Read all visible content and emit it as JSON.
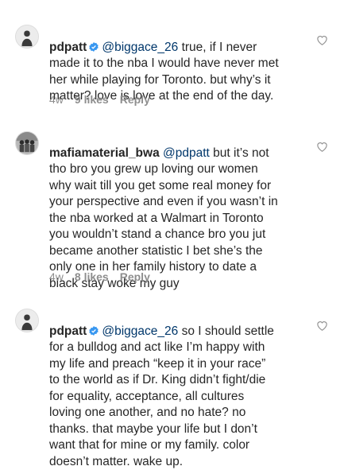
{
  "comments": [
    {
      "username": "pdpatt",
      "verified": true,
      "mention": "@biggace_26",
      "text": " true, if I never\nmade it to the nba I would have never met\nher while playing for Toronto. but why’s it\nmatter? love is love at the end of the day.",
      "time": "4w",
      "likes": "9 likes",
      "reply": "Reply"
    },
    {
      "username": "mafiamaterial_bwa",
      "verified": false,
      "mention": "@pdpatt",
      "text": " but it’s not\ntho bro you grew up loving our women\nwhy wait till you get some real money for\nyour perspective and even if you wasn’t in\nthe nba worked at a Walmart in Toronto\nyou wouldn’t stand a chance bro you jut\nbecame another statistic I bet she’s the\nonly one in her family history to date a\nblack stay woke my guy",
      "time": "4w",
      "likes": "8 likes",
      "reply": "Reply"
    },
    {
      "username": "pdpatt",
      "verified": true,
      "mention": "@biggace_26",
      "text": " so I should settle\nfor a bulldog and act like I’m happy with\nmy life and preach “keep it in your race”\nto the world as if Dr. King didn’t fight/die\nfor equality, acceptance, all cultures\nloving one another, and no hate? no\nthanks. that maybe your life but I don’t\nwant that for mine or my family. color\ndoesn’t matter. wake up."
    }
  ],
  "icons": {
    "heart": "heart-outline-icon",
    "verified": "verified-badge-icon",
    "verified_color": "#3897f0"
  }
}
